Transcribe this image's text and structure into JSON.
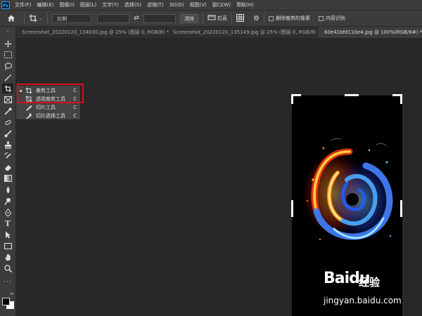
{
  "app": {
    "logo_text": "Ps"
  },
  "menu": [
    "文件(F)",
    "编辑(E)",
    "图像(I)",
    "图层(L)",
    "文字(Y)",
    "选择(S)",
    "滤镜(T)",
    "3D(D)",
    "视图(V)",
    "窗口(W)",
    "帮助(H)"
  ],
  "options": {
    "ratio_label": "比例",
    "clear_label": "清除",
    "straighten_label": "拉直",
    "delete_cropped_label": "删除裁剪的像素",
    "content_aware_label": "内容识别"
  },
  "tabs": [
    {
      "label": "Screenshot_20220120_134030.jpg @ 25% (图层 0, RGB/8) *"
    },
    {
      "label": "Screenshot_20220120_135149.jpg @ 25% (图层 0, RGB/8) *"
    },
    {
      "label": "60e41bfd110e4.jpg @ 100%(RGB/8#) *"
    }
  ],
  "flyout": {
    "items": [
      {
        "label": "裁剪工具",
        "key": "C",
        "icon": "crop-icon",
        "selected": true
      },
      {
        "label": "透视裁剪工具",
        "key": "C",
        "icon": "perspective-crop-icon",
        "selected": false
      },
      {
        "label": "切片工具",
        "key": "C",
        "icon": "slice-icon",
        "selected": false
      },
      {
        "label": "切片选择工具",
        "key": "C",
        "icon": "slice-select-icon",
        "selected": false
      }
    ]
  },
  "watermark": {
    "logo": "Baidu",
    "text": "经验",
    "url": "jingyan.baidu.com"
  },
  "colors": {
    "highlight": "#d8101a",
    "foreground": "#000000",
    "background": "#ffffff"
  }
}
